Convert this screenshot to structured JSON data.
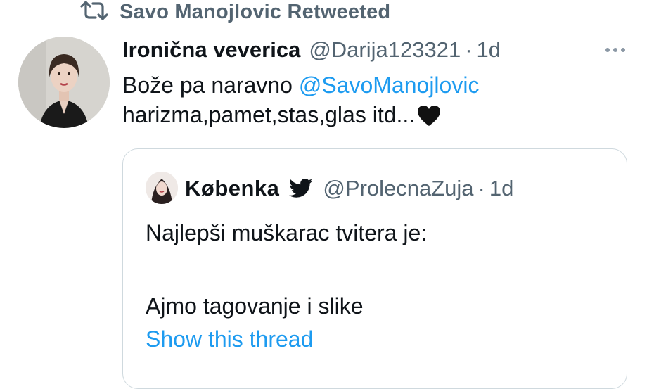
{
  "retweet": {
    "label": "Savo Manojlovic Retweeted",
    "icon": "retweet-icon"
  },
  "tweet": {
    "display_name": "Ironična veverica",
    "handle": "@Darija123321",
    "separator": "·",
    "time": "1d",
    "text_line1_prefix": "Bože pa naravno ",
    "mention": "@SavoManojlovic",
    "text_line2": "harizma,pamet,stas,glas itd...",
    "emoji": "black-heart-icon",
    "more_icon": "more-icon"
  },
  "quote": {
    "display_name": "Købenka",
    "verified_icon": "twitter-bird-icon",
    "handle": "@ProlecnaZuja",
    "separator": "·",
    "time": "1d",
    "text_line1": "Najlepši muškarac tvitera je:",
    "text_line2": "Ajmo tagovanje i slike",
    "show_thread": "Show this thread"
  },
  "colors": {
    "accent": "#1d9bf0",
    "secondary_text": "#536471",
    "primary_text": "#0f1419",
    "border": "#cfd9de"
  }
}
